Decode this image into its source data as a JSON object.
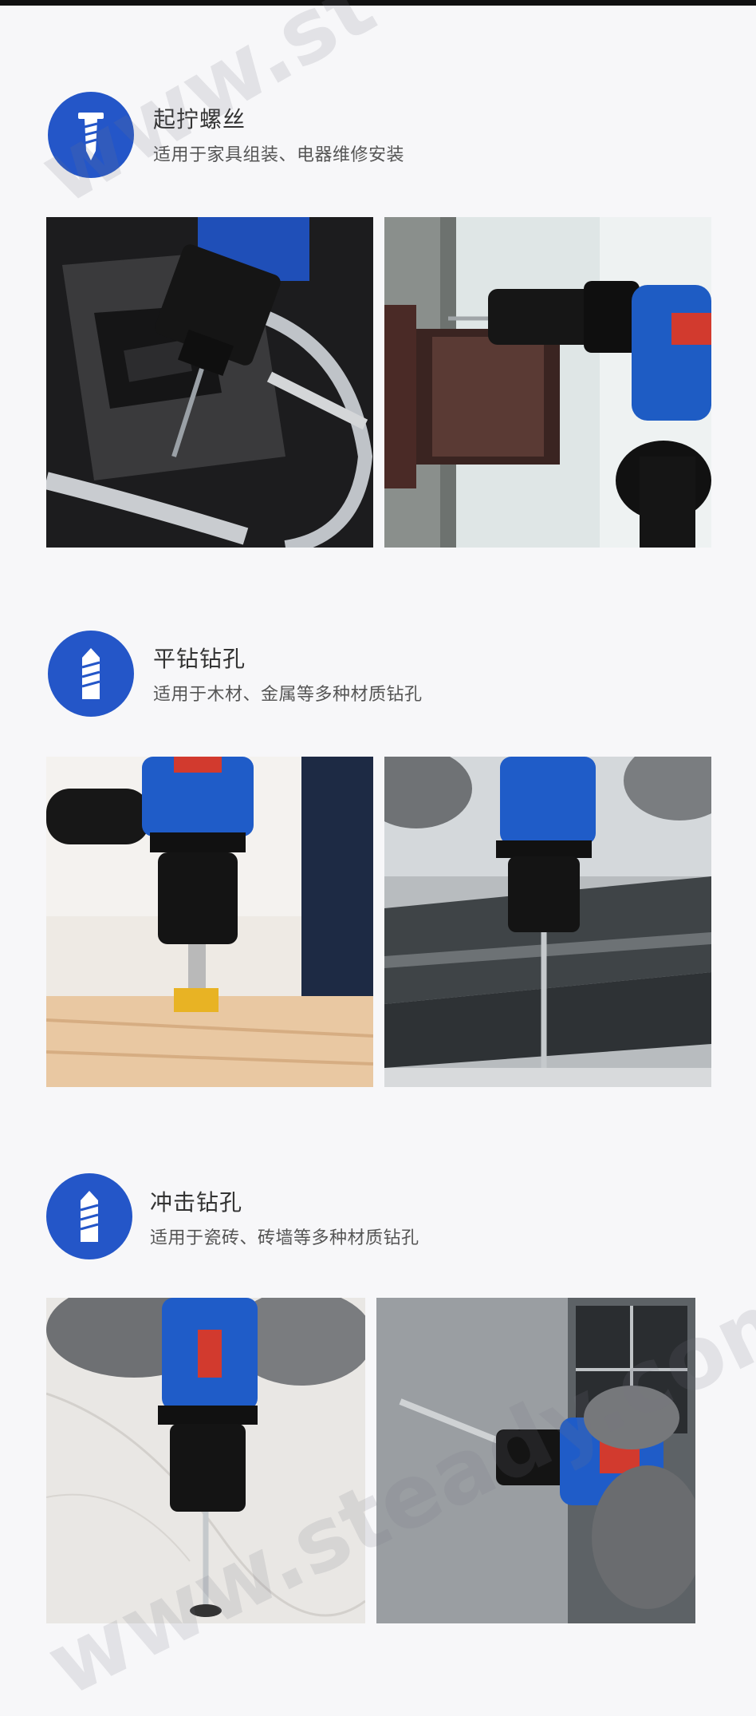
{
  "colors": {
    "accent": "#2456c8",
    "background": "#f7f7f9"
  },
  "sections": [
    {
      "icon": "screw-icon",
      "title": "起拧螺丝",
      "subtitle": "适用于家具组装、电器维修安装",
      "photos": [
        {
          "description_icon": "drill-screwing-hinge-case-photo"
        },
        {
          "description_icon": "drill-screwing-door-hinge-photo"
        }
      ]
    },
    {
      "icon": "drill-bit-icon",
      "title": "平钻钻孔",
      "subtitle": "适用于木材、金属等多种材质钻孔",
      "photos": [
        {
          "description_icon": "drill-wood-photo"
        },
        {
          "description_icon": "drill-metal-photo"
        }
      ]
    },
    {
      "icon": "drill-bit-icon",
      "title": "冲击钻孔",
      "subtitle": "适用于瓷砖、砖墙等多种材质钻孔",
      "photos": [
        {
          "description_icon": "drill-tile-photo"
        },
        {
          "description_icon": "drill-brick-wall-photo"
        }
      ]
    }
  ],
  "watermark": {
    "top_left": "www.st",
    "bottom": "www.steady.com"
  }
}
